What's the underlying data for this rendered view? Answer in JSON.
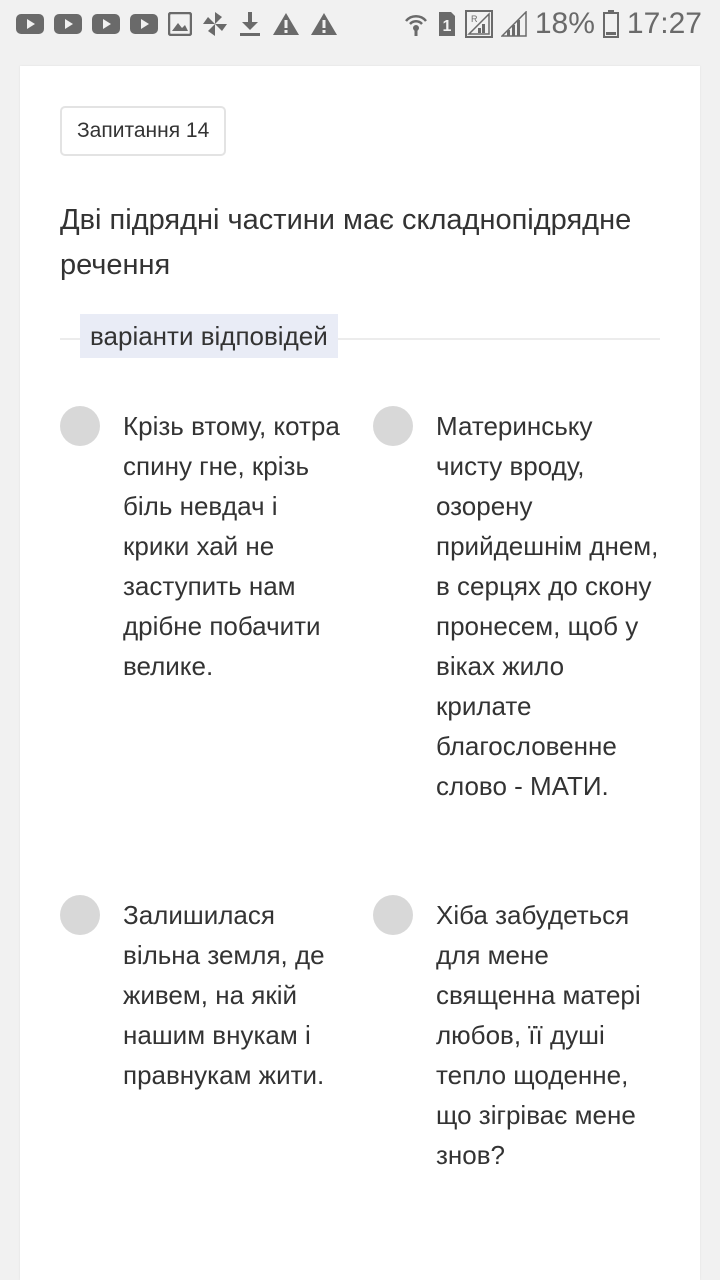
{
  "status_bar": {
    "battery": "18%",
    "time": "17:27",
    "icons": [
      "youtube-icon",
      "youtube-icon",
      "youtube-icon",
      "youtube-icon",
      "image-icon",
      "pinwheel-icon",
      "download-icon",
      "warning-icon",
      "warning-icon",
      "hotspot-icon",
      "sim-1-icon",
      "signal-r-icon",
      "signal-icon",
      "battery-icon"
    ]
  },
  "question": {
    "badge": "Запитання 14",
    "text": "Дві підрядні частини має складнопідрядне речення",
    "answers_label": "варіанти відповідей"
  },
  "options": [
    {
      "text": "Крізь втому, котра спину гне, крізь біль невдач і крики хай не заступить нам дрібне побачити велике."
    },
    {
      "text": "Материнську чисту вроду, озорену прийдешнім днем, в серцях до скону пронесем, щоб у віках жило крилате благословенне слово - МАТИ."
    },
    {
      "text": "Залишилася вільна земля, де живем, на якій нашим внукам і правнукам жити."
    },
    {
      "text": "Хіба забудеться для мене священна матері любов, її душі тепло щоденне, що зігріває мене знов?"
    }
  ],
  "colors": {
    "background": "#f1f1f1",
    "card": "#ffffff",
    "label_bg": "#e9ecf6",
    "radio": "#d8d8d8",
    "status_icons": "#6a6a6a"
  }
}
